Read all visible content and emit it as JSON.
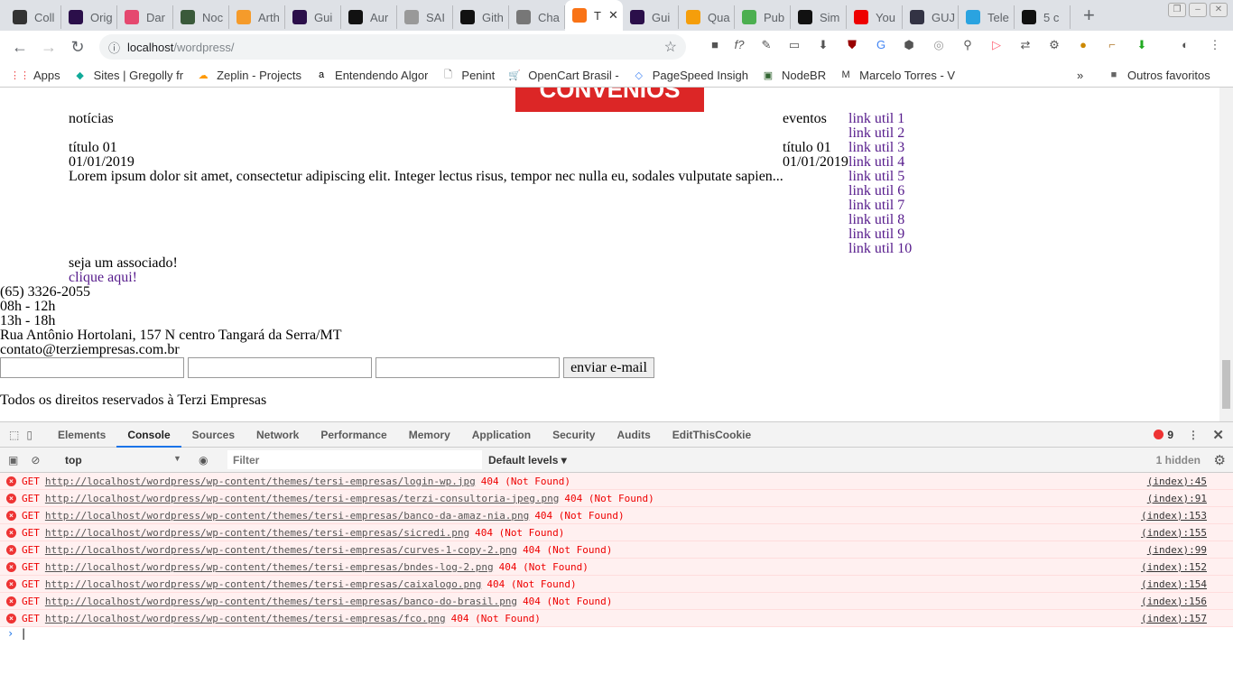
{
  "tabs": [
    {
      "label": "Coll",
      "color": "#333"
    },
    {
      "label": "Orig",
      "color": "#2b0f4a"
    },
    {
      "label": "Dar",
      "color": "#e5486f"
    },
    {
      "label": "Noc",
      "color": "#3a5a3a"
    },
    {
      "label": "Arth",
      "color": "#f59b2b"
    },
    {
      "label": "Gui",
      "color": "#2b0f4a"
    },
    {
      "label": "Aur",
      "color": "#111"
    },
    {
      "label": "SAI",
      "color": "#999"
    },
    {
      "label": "Gith",
      "color": "#111"
    },
    {
      "label": "Cha",
      "color": "#777"
    },
    {
      "label": "T",
      "color": "#f97316",
      "active": true
    },
    {
      "label": "Gui",
      "color": "#2b0f4a"
    },
    {
      "label": "Qua",
      "color": "#f59e0b"
    },
    {
      "label": "Pub",
      "color": "#4caf50"
    },
    {
      "label": "Sim",
      "color": "#111"
    },
    {
      "label": "You",
      "color": "#e00"
    },
    {
      "label": "GUJ",
      "color": "#334"
    },
    {
      "label": "Tele",
      "color": "#2aa3e0"
    },
    {
      "label": "5 c",
      "color": "#111"
    }
  ],
  "address": {
    "host": "localhost",
    "path": "/wordpress/"
  },
  "bookmarks": [
    "Apps",
    "Sites | Gregolly fr",
    "Zeplin - Projects",
    "Entendendo Algor",
    "Penint",
    "OpenCart Brasil -",
    "PageSpeed Insigh",
    "NodeBR",
    "Marcelo Torres - V"
  ],
  "other_bookmarks": "Outros favoritos",
  "page": {
    "banner": "CONVENIOS",
    "news_heading": "notícias",
    "news_title": "título 01",
    "news_date": "01/01/2019",
    "news_excerpt": "Lorem ipsum dolor sit amet, consectetur adipiscing elit. Integer lectus risus, tempor nec nulla eu, sodales vulputate sapien...",
    "events_heading": "eventos",
    "event_title": "título 01",
    "event_date": "01/01/2019",
    "links": [
      "link util 1",
      "link util 2",
      "link util 3",
      "link util 4",
      "link util 5",
      "link util 6",
      "link util 7",
      "link util 8",
      "link util 9",
      "link util 10"
    ],
    "associate": "seja um associado!",
    "associate_link": "clique aqui!",
    "phone": "(65) 3326-2055",
    "hours1": "08h - 12h",
    "hours2": "13h - 18h",
    "address": "Rua Antônio Hortolani, 157 N centro Tangará da Serra/MT",
    "email": "contato@terziempresas.com.br",
    "send_button": "enviar e-mail",
    "footer": "Todos os direitos reservados à Terzi Empresas"
  },
  "devtools": {
    "tabs": [
      "Elements",
      "Console",
      "Sources",
      "Network",
      "Performance",
      "Memory",
      "Application",
      "Security",
      "Audits",
      "EditThisCookie"
    ],
    "error_count": "9",
    "context": "top",
    "filter_placeholder": "Filter",
    "levels": "Default levels ▾",
    "hidden": "1 hidden",
    "messages": [
      {
        "url": "http://localhost/wordpress/wp-content/themes/tersi-empresas/login-wp.jpg",
        "src": "(index):45"
      },
      {
        "url": "http://localhost/wordpress/wp-content/themes/tersi-empresas/terzi-consultoria-jpeg.png",
        "src": "(index):91"
      },
      {
        "url": "http://localhost/wordpress/wp-content/themes/tersi-empresas/banco-da-amaz-nia.png",
        "src": "(index):153"
      },
      {
        "url": "http://localhost/wordpress/wp-content/themes/tersi-empresas/sicredi.png",
        "src": "(index):155"
      },
      {
        "url": "http://localhost/wordpress/wp-content/themes/tersi-empresas/curves-1-copy-2.png",
        "src": "(index):99"
      },
      {
        "url": "http://localhost/wordpress/wp-content/themes/tersi-empresas/bndes-log-2.png",
        "src": "(index):152"
      },
      {
        "url": "http://localhost/wordpress/wp-content/themes/tersi-empresas/caixalogo.png",
        "src": "(index):154"
      },
      {
        "url": "http://localhost/wordpress/wp-content/themes/tersi-empresas/banco-do-brasil.png",
        "src": "(index):156"
      },
      {
        "url": "http://localhost/wordpress/wp-content/themes/tersi-empresas/fco.png",
        "src": "(index):157"
      }
    ],
    "method": "GET",
    "status": "404 (Not Found)"
  }
}
